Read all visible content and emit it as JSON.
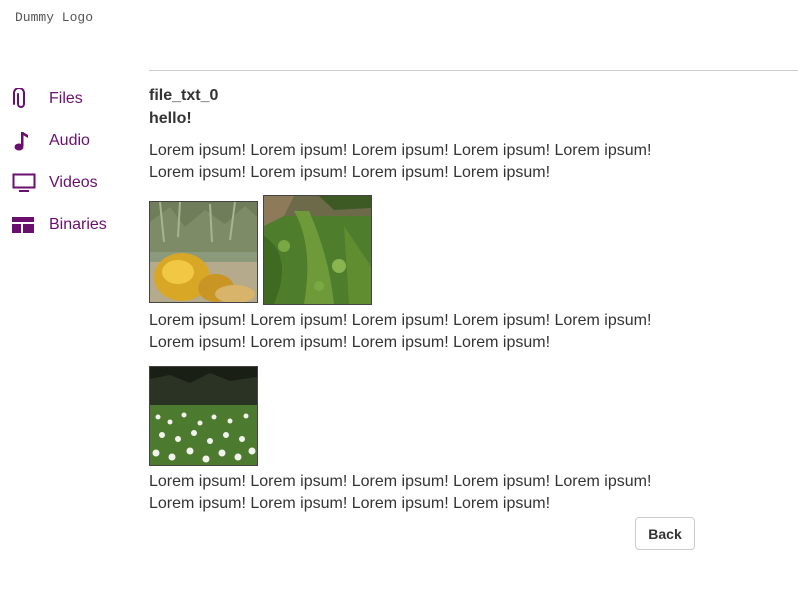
{
  "header": {
    "logo_text": "Dummy Logo"
  },
  "sidebar": {
    "items": [
      {
        "label": "Files",
        "icon": "paperclip-icon"
      },
      {
        "label": "Audio",
        "icon": "music-note-icon"
      },
      {
        "label": "Videos",
        "icon": "monitor-icon"
      },
      {
        "label": "Binaries",
        "icon": "table-icon"
      }
    ]
  },
  "main": {
    "title": "file_txt_0",
    "subtitle": "hello!",
    "paragraphs": [
      "Lorem ipsum! Lorem ipsum! Lorem ipsum! Lorem ipsum! Lorem ipsum! Lorem ipsum! Lorem ipsum! Lorem ipsum! Lorem ipsum!",
      "Lorem ipsum! Lorem ipsum! Lorem ipsum! Lorem ipsum! Lorem ipsum! Lorem ipsum! Lorem ipsum! Lorem ipsum! Lorem ipsum!",
      "Lorem ipsum! Lorem ipsum! Lorem ipsum! Lorem ipsum! Lorem ipsum! Lorem ipsum! Lorem ipsum! Lorem ipsum! Lorem ipsum!"
    ],
    "back_label": "Back"
  },
  "colors": {
    "accent": "#6a0f6e",
    "text": "#333333",
    "divider": "#cccccc"
  }
}
